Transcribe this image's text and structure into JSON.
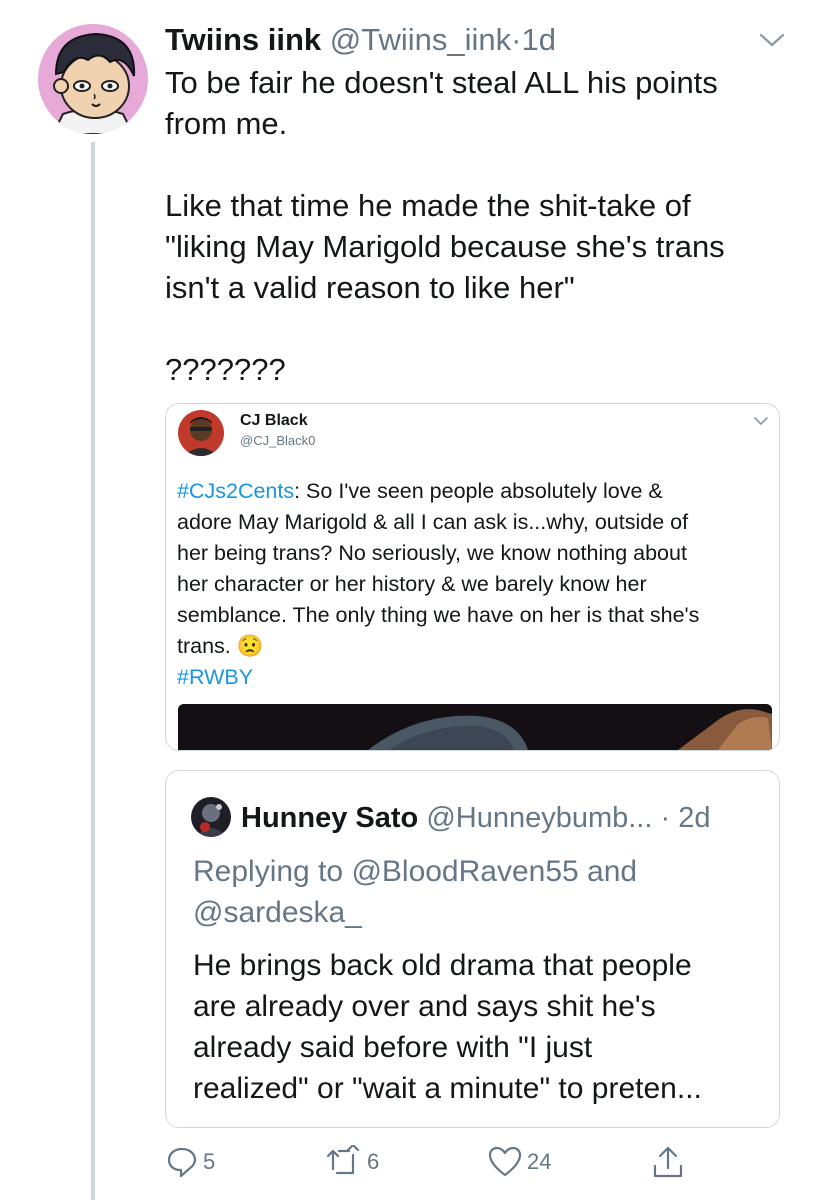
{
  "tweet": {
    "author_name": "Twiins iink",
    "author_handle": "@Twiins_iink",
    "separator": "·",
    "time": "1d",
    "paragraphs": [
      "To be fair he doesn't steal ALL his points\nfrom me.",
      "Like that time he made the shit-take of\n\"liking May Marigold because she's trans\nisn't a valid reason to like her\"",
      "???????"
    ]
  },
  "quoted_tweet": {
    "author_name": "CJ Black",
    "author_handle": "@CJ_Black0",
    "hashtag1": "#CJs2Cents",
    "text_line1": ": So I've seen people absolutely love &",
    "text_rest": "adore May Marigold & all I can ask is...why, outside of\nher being trans? No seriously, we know nothing about\nher character or her history & we barely know her\nsemblance. The only thing we have on her is that she's\ntrans. ",
    "emoji": "😟",
    "hashtag2": "#RWBY"
  },
  "reply_tweet": {
    "author_name": "Hunney Sato",
    "author_handle": "@Hunneybumb...",
    "separator": "·",
    "time": "2d",
    "replying_prefix": "Replying to ",
    "mention1": "@BloodRaven55",
    "and_word": " and",
    "mention2": "@sardeska_",
    "text": "He brings back old drama that people\nare already over and says shit he's\nalready said before with \"I just\nrealized\" or \"wait a minute\" to preten..."
  },
  "actions": {
    "reply_count": "5",
    "retweet_count": "6",
    "like_count": "24",
    "icons": [
      "reply-icon",
      "retweet-icon",
      "like-icon",
      "share-icon"
    ]
  },
  "colors": {
    "link": "#1b95e0",
    "secondary_text": "#657786",
    "thread_line": "#ccd6dd"
  }
}
